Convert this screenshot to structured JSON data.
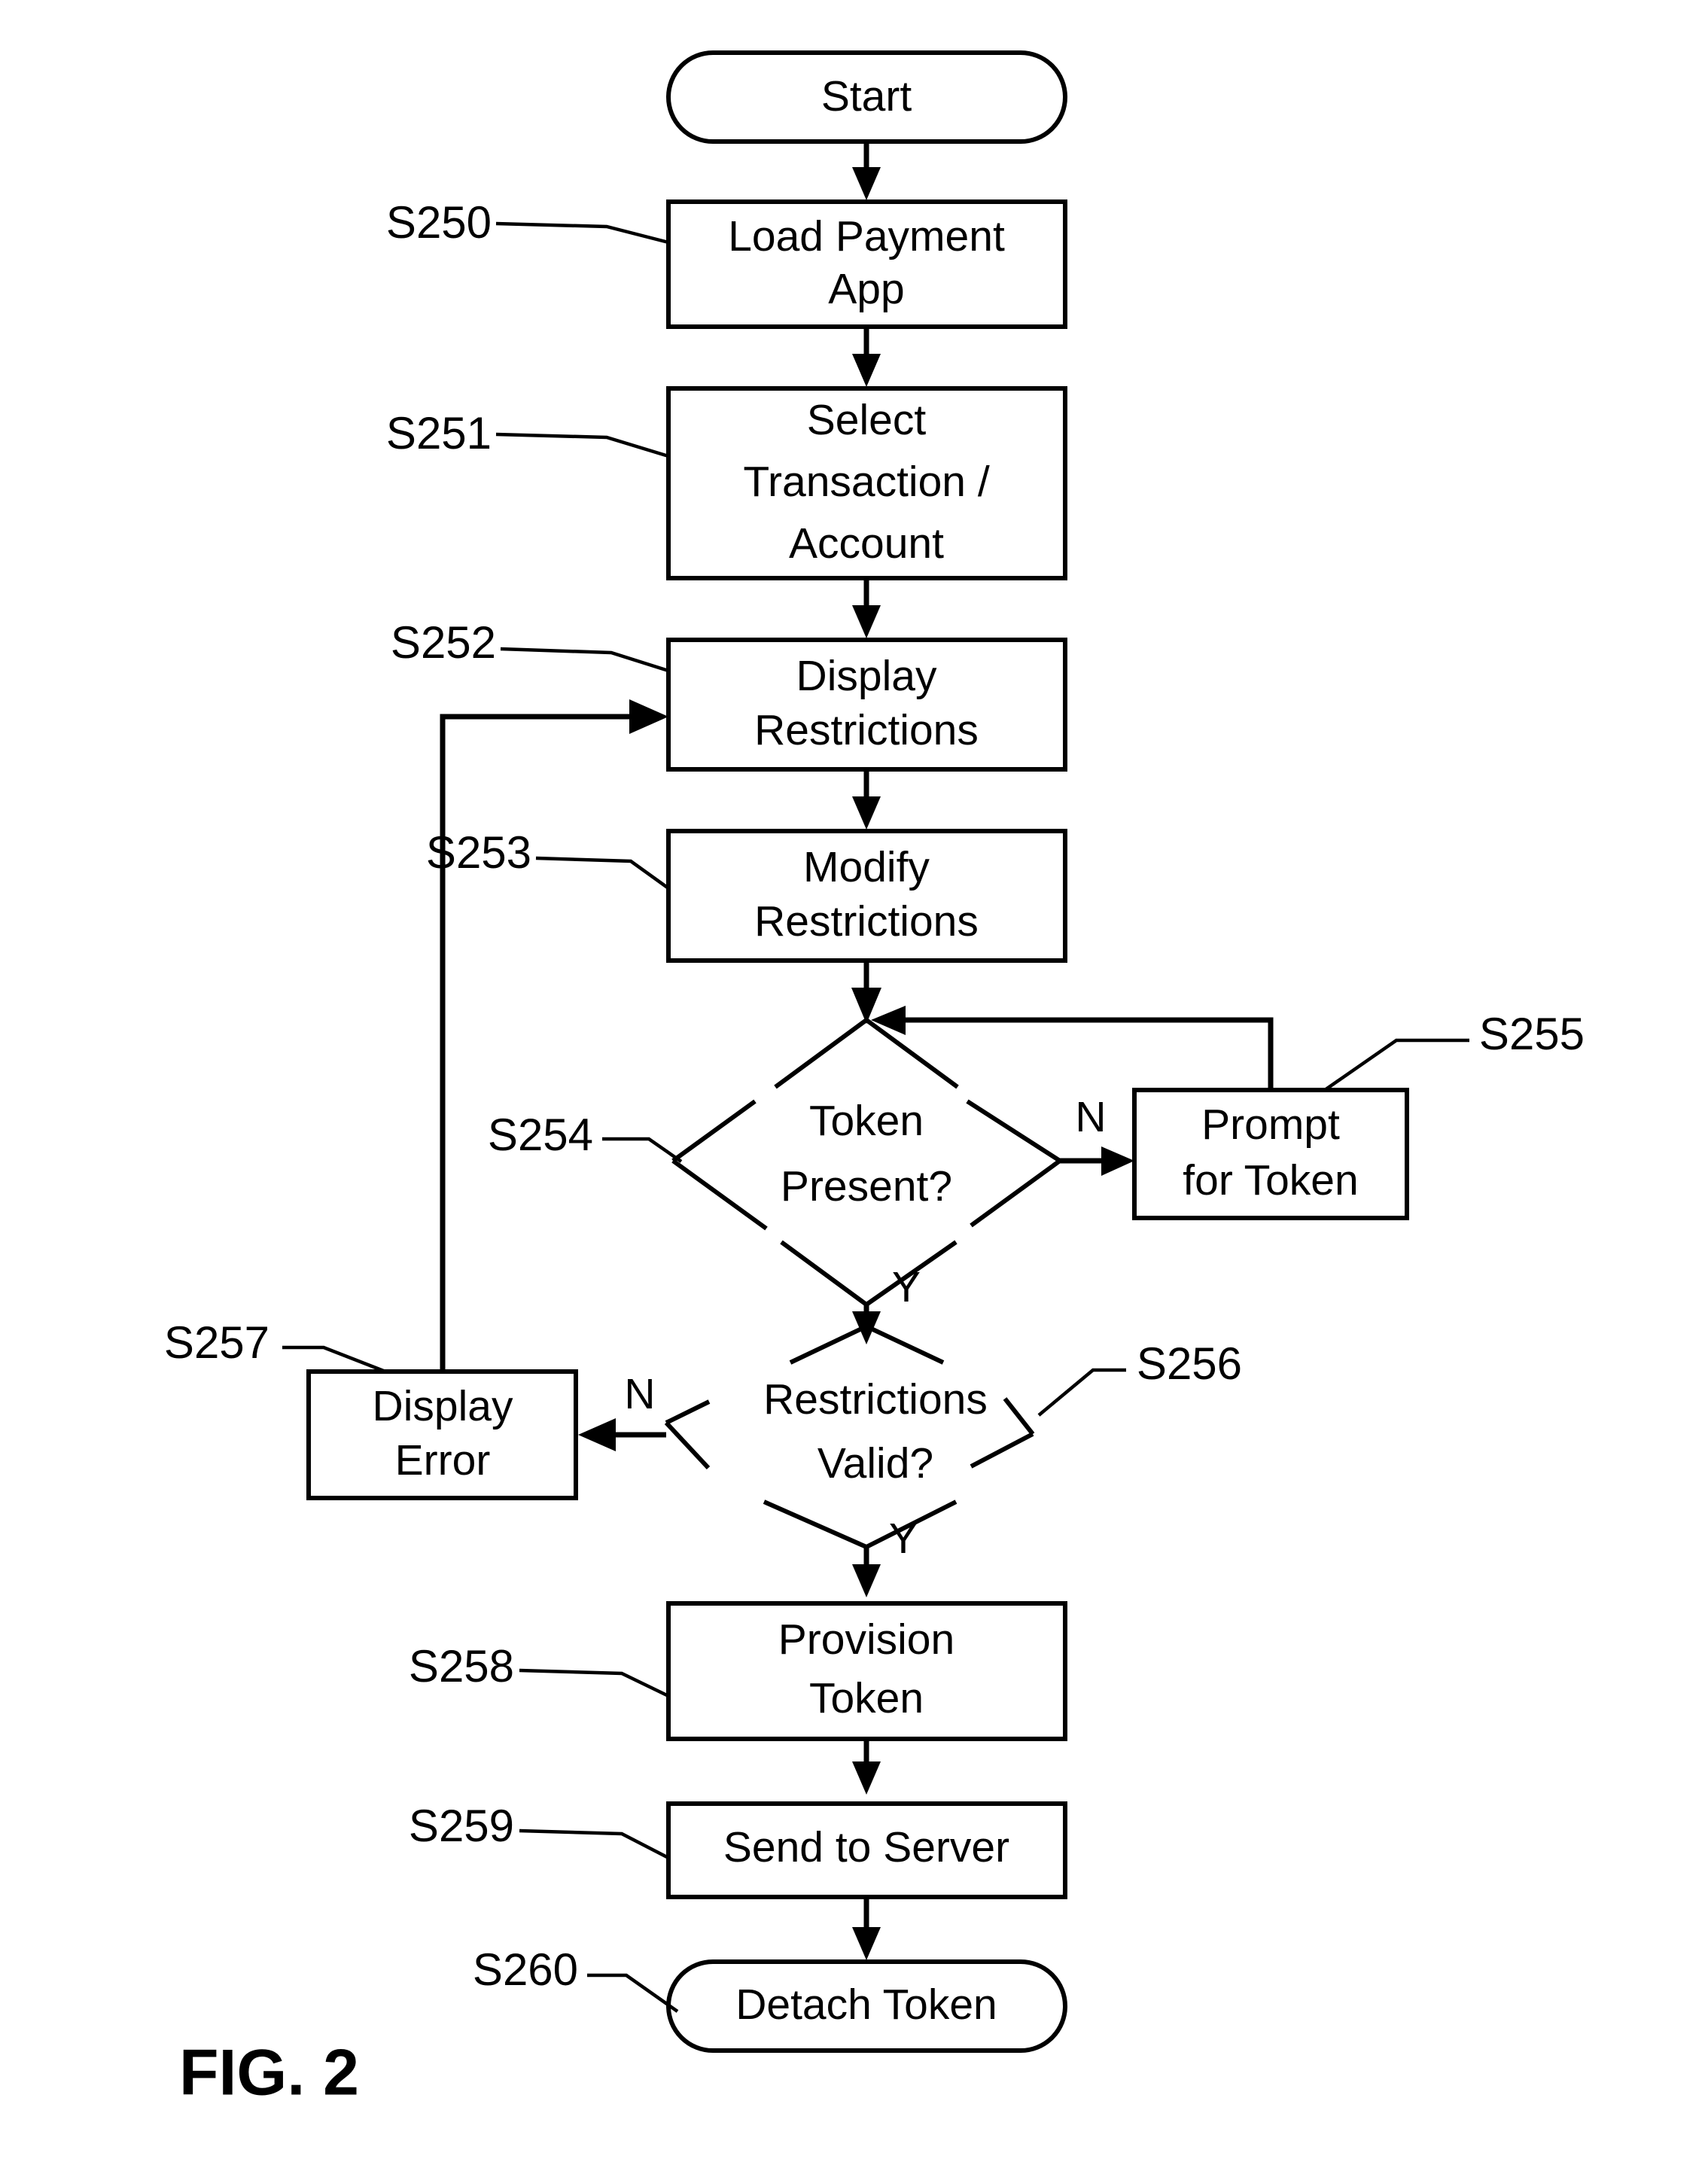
{
  "figure": {
    "caption": "FIG. 2",
    "title": "Token provisioning flowchart"
  },
  "nodes": {
    "start": {
      "ref": "",
      "lines": [
        "Start"
      ],
      "shape": "terminator"
    },
    "load_app": {
      "ref": "S250",
      "lines": [
        "Load Payment",
        "App"
      ],
      "shape": "process"
    },
    "select_txn": {
      "ref": "S251",
      "lines": [
        "Select",
        "Transaction /",
        "Account"
      ],
      "shape": "process"
    },
    "display_restr": {
      "ref": "S252",
      "lines": [
        "Display",
        "Restrictions"
      ],
      "shape": "process"
    },
    "modify_restr": {
      "ref": "S253",
      "lines": [
        "Modify",
        "Restrictions"
      ],
      "shape": "process"
    },
    "token_present": {
      "ref": "S254",
      "lines": [
        "Token",
        "Present?"
      ],
      "shape": "decision"
    },
    "prompt_token": {
      "ref": "S255",
      "lines": [
        "Prompt",
        "for Token"
      ],
      "shape": "process"
    },
    "restr_valid": {
      "ref": "S256",
      "lines": [
        "Restrictions",
        "Valid?"
      ],
      "shape": "decision"
    },
    "display_error": {
      "ref": "S257",
      "lines": [
        "Display",
        "Error"
      ],
      "shape": "process"
    },
    "provision": {
      "ref": "S258",
      "lines": [
        "Provision",
        "Token"
      ],
      "shape": "process"
    },
    "send_server": {
      "ref": "S259",
      "lines": [
        "Send to Server"
      ],
      "shape": "process"
    },
    "detach_token": {
      "ref": "S260",
      "lines": [
        "Detach Token"
      ],
      "shape": "terminator"
    }
  },
  "branch_labels": {
    "token_no": "N",
    "token_yes": "Y",
    "valid_no": "N",
    "valid_yes": "Y"
  },
  "text": {
    "start": "Start",
    "load_app_l1": "Load Payment",
    "load_app_l2": "App",
    "select_txn_l1": "Select",
    "select_txn_l2": "Transaction /",
    "select_txn_l3": "Account",
    "display_restr_l1": "Display",
    "display_restr_l2": "Restrictions",
    "modify_restr_l1": "Modify",
    "modify_restr_l2": "Restrictions",
    "token_present_l1": "Token",
    "token_present_l2": "Present?",
    "prompt_token_l1": "Prompt",
    "prompt_token_l2": "for Token",
    "restr_valid_l1": "Restrictions",
    "restr_valid_l2": "Valid?",
    "display_error_l1": "Display",
    "display_error_l2": "Error",
    "provision_l1": "Provision",
    "provision_l2": "Token",
    "send_server_l1": "Send to Server",
    "detach_token_l1": "Detach Token"
  },
  "refs": {
    "s250": "S250",
    "s251": "S251",
    "s252": "S252",
    "s253": "S253",
    "s254": "S254",
    "s255": "S255",
    "s256": "S256",
    "s257": "S257",
    "s258": "S258",
    "s259": "S259",
    "s260": "S260"
  },
  "colors": {
    "stroke": "#000000",
    "background": "#ffffff"
  },
  "chart_data": {
    "type": "flowchart",
    "title": "FIG. 2",
    "orientation": "top-to-bottom",
    "steps": [
      {
        "id": "start",
        "ref": "",
        "label": "Start",
        "type": "terminator",
        "next": [
          "load_app"
        ]
      },
      {
        "id": "load_app",
        "ref": "S250",
        "label": "Load Payment App",
        "type": "process",
        "next": [
          "select_txn"
        ]
      },
      {
        "id": "select_txn",
        "ref": "S251",
        "label": "Select Transaction / Account",
        "type": "process",
        "next": [
          "display_restr"
        ]
      },
      {
        "id": "display_restr",
        "ref": "S252",
        "label": "Display Restrictions",
        "type": "process",
        "next": [
          "modify_restr"
        ]
      },
      {
        "id": "modify_restr",
        "ref": "S253",
        "label": "Modify Restrictions",
        "type": "process",
        "next": [
          "token_present"
        ]
      },
      {
        "id": "token_present",
        "ref": "S254",
        "label": "Token Present?",
        "type": "decision",
        "next": [
          "prompt_token",
          "restr_valid"
        ],
        "branches": {
          "N": "prompt_token",
          "Y": "restr_valid"
        }
      },
      {
        "id": "prompt_token",
        "ref": "S255",
        "label": "Prompt for Token",
        "type": "process",
        "next": [
          "token_present"
        ]
      },
      {
        "id": "restr_valid",
        "ref": "S256",
        "label": "Restrictions Valid?",
        "type": "decision",
        "next": [
          "display_error",
          "provision"
        ],
        "branches": {
          "N": "display_error",
          "Y": "provision"
        }
      },
      {
        "id": "display_error",
        "ref": "S257",
        "label": "Display Error",
        "type": "process",
        "next": [
          "display_restr"
        ]
      },
      {
        "id": "provision",
        "ref": "S258",
        "label": "Provision Token",
        "type": "process",
        "next": [
          "send_server"
        ]
      },
      {
        "id": "send_server",
        "ref": "S259",
        "label": "Send to Server",
        "type": "process",
        "next": [
          "detach_token"
        ]
      },
      {
        "id": "detach_token",
        "ref": "S260",
        "label": "Detach Token",
        "type": "terminator",
        "next": []
      }
    ]
  }
}
